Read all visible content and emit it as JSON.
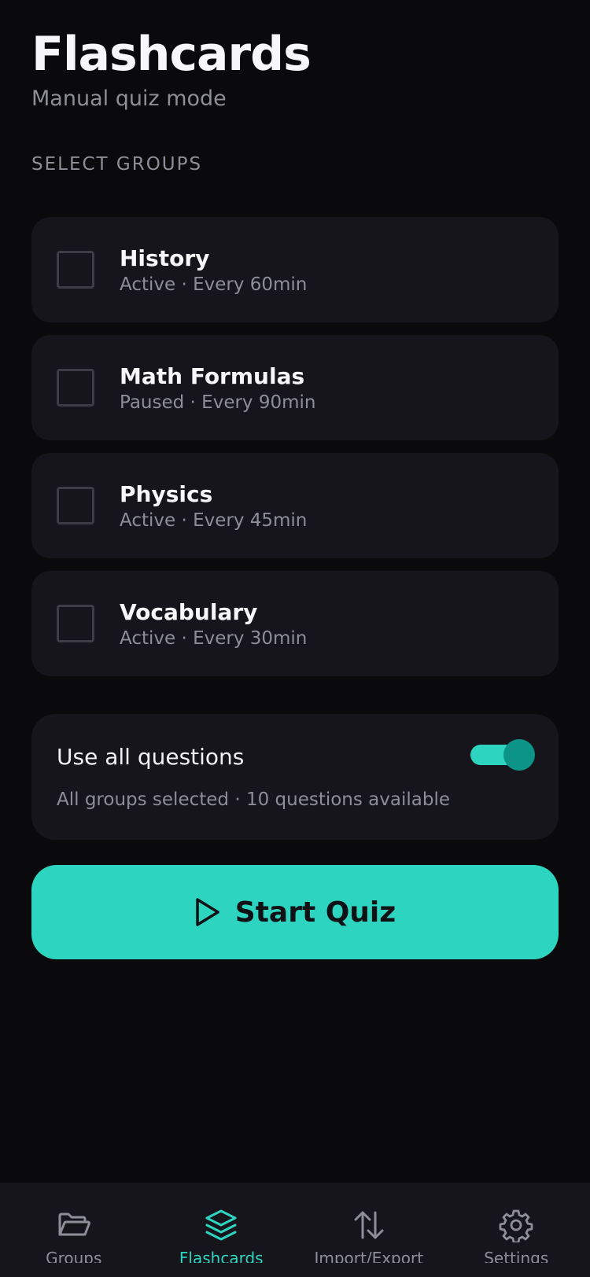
{
  "header": {
    "title": "Flashcards",
    "subtitle": "Manual quiz mode"
  },
  "section_label": "SELECT GROUPS",
  "groups": [
    {
      "name": "History",
      "status": "Active",
      "interval": "Every 60min",
      "meta": "Active · Every 60min",
      "checked": false
    },
    {
      "name": "Math Formulas",
      "status": "Paused",
      "interval": "Every 90min",
      "meta": "Paused · Every 90min",
      "checked": false
    },
    {
      "name": "Physics",
      "status": "Active",
      "interval": "Every 45min",
      "meta": "Active · Every 45min",
      "checked": false
    },
    {
      "name": "Vocabulary",
      "status": "Active",
      "interval": "Every 30min",
      "meta": "Active · Every 30min",
      "checked": false
    }
  ],
  "use_all": {
    "label": "Use all questions",
    "enabled": true,
    "description": "All groups selected · 10 questions available"
  },
  "start_button": {
    "label": "Start Quiz",
    "icon": "play-icon"
  },
  "tabbar": {
    "active": "flashcards",
    "tabs": [
      {
        "id": "groups",
        "label": "Groups",
        "icon": "folder-open-icon"
      },
      {
        "id": "flashcards",
        "label": "Flashcards",
        "icon": "layers-icon"
      },
      {
        "id": "import-export",
        "label": "Import/Export",
        "icon": "arrows-up-down-icon"
      },
      {
        "id": "settings",
        "label": "Settings",
        "icon": "gear-icon"
      }
    ]
  },
  "colors": {
    "background": "#0a0a0c",
    "card": "#15151b",
    "accent": "#2dd4bf",
    "accent_dark": "#0d9488",
    "muted_text": "#8e8e98"
  }
}
